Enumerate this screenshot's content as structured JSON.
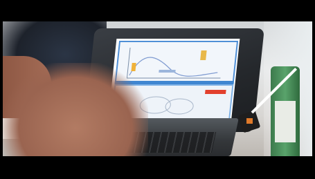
{
  "scene": {
    "accent_colors": {
      "screen_blue": "#4f8fd6",
      "bottle_green": "#59a36b",
      "skin": "#a46c56"
    }
  }
}
